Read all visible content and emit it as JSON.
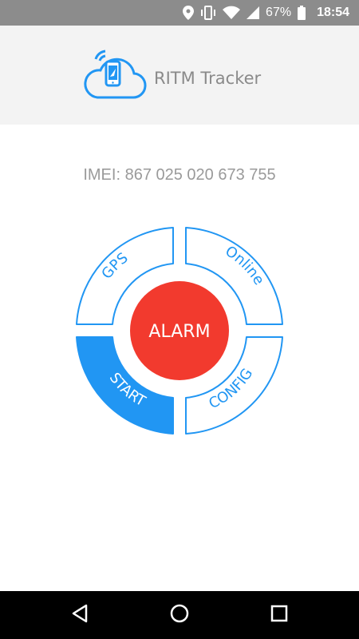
{
  "status_bar": {
    "battery_percent": "67%",
    "time": "18:54",
    "icons": [
      "location-icon",
      "vibrate-icon",
      "wifi-icon",
      "cell-signal-icon",
      "battery-icon"
    ]
  },
  "header": {
    "title": "RITM Tracker",
    "logo_icon": "cloud-phone-icon"
  },
  "imei_text": "IMEI: 867 025 020 673 755",
  "control_pad": {
    "gps": "GPS",
    "online": "Online",
    "start": "START",
    "config": "CONFIG",
    "alarm": "ALARM"
  },
  "colors": {
    "accent_blue": "#2196F3",
    "alarm_red": "#F23A2E",
    "header_bg": "#F3F3F3"
  },
  "nav_bar": {
    "icons": [
      "back-icon",
      "home-icon",
      "recents-icon"
    ]
  }
}
